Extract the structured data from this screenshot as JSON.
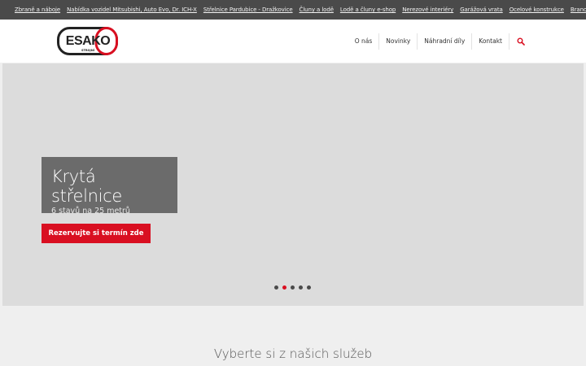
{
  "topbar": {
    "links": [
      "Zbraně a náboje",
      "Nabídka vozidel Mitsubishi, Auto Evo, Dr. ICH-X",
      "Střelnice Pardubice - Dražkovice",
      "Čluny a lodě",
      "Lodě a čluny e-shop",
      "Nerezové interiéry",
      "Garážová vrata",
      "Ocelové konstrukce",
      "Branové a kované prvky e-shop"
    ]
  },
  "logo": {
    "main": "ESAKO",
    "sub": "STROJNÍ"
  },
  "nav": {
    "items": [
      "O nás",
      "Novinky",
      "Náhradní díly",
      "Kontakt"
    ]
  },
  "hero": {
    "title": "Krytá střelnice",
    "subtitle": "6 stavů na 25 metrů",
    "cta": "Rezervujte si termín zde",
    "slides_total": 5,
    "active_slide": 2
  },
  "section": {
    "heading": "Vyberte si z našich služeb"
  },
  "colors": {
    "accent": "#d90f21",
    "topbar": "#4a4a4a",
    "hero_bg": "#dcdcdc"
  }
}
